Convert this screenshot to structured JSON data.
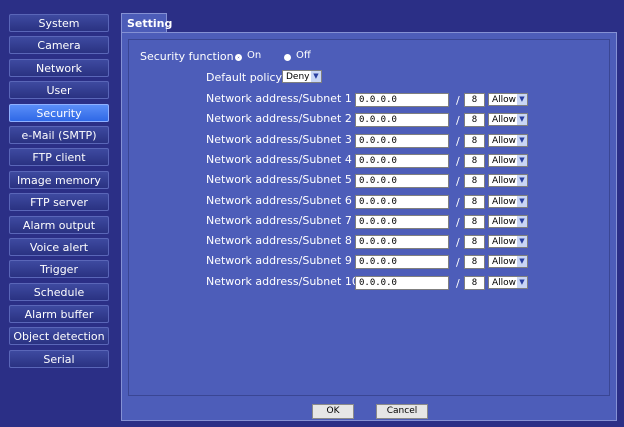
{
  "sidebar": {
    "items": [
      {
        "label": "System"
      },
      {
        "label": "Camera"
      },
      {
        "label": "Network"
      },
      {
        "label": "User"
      },
      {
        "label": "Security"
      },
      {
        "label": "e-Mail (SMTP)"
      },
      {
        "label": "FTP client"
      },
      {
        "label": "Image memory"
      },
      {
        "label": "FTP server"
      },
      {
        "label": "Alarm output"
      },
      {
        "label": "Voice alert"
      },
      {
        "label": "Trigger"
      },
      {
        "label": "Schedule"
      },
      {
        "label": "Alarm buffer"
      },
      {
        "label": "Object detection"
      },
      {
        "label": "Serial"
      }
    ],
    "active_index": 4
  },
  "tab": {
    "label": "Setting"
  },
  "security": {
    "function_label": "Security function",
    "on_label": "On",
    "off_label": "Off",
    "selected": "On",
    "default_policy_label": "Default policy",
    "default_policy_value": "Deny"
  },
  "rows": [
    {
      "label": "Network address/Subnet 1",
      "address": "0.0.0.0",
      "slash": "/",
      "subnet": "8",
      "policy": "Allow"
    },
    {
      "label": "Network address/Subnet 2",
      "address": "0.0.0.0",
      "slash": "/",
      "subnet": "8",
      "policy": "Allow"
    },
    {
      "label": "Network address/Subnet 3",
      "address": "0.0.0.0",
      "slash": "/",
      "subnet": "8",
      "policy": "Allow"
    },
    {
      "label": "Network address/Subnet 4",
      "address": "0.0.0.0",
      "slash": "/",
      "subnet": "8",
      "policy": "Allow"
    },
    {
      "label": "Network address/Subnet 5",
      "address": "0.0.0.0",
      "slash": "/",
      "subnet": "8",
      "policy": "Allow"
    },
    {
      "label": "Network address/Subnet 6",
      "address": "0.0.0.0",
      "slash": "/",
      "subnet": "8",
      "policy": "Allow"
    },
    {
      "label": "Network address/Subnet 7",
      "address": "0.0.0.0",
      "slash": "/",
      "subnet": "8",
      "policy": "Allow"
    },
    {
      "label": "Network address/Subnet 8",
      "address": "0.0.0.0",
      "slash": "/",
      "subnet": "8",
      "policy": "Allow"
    },
    {
      "label": "Network address/Subnet 9",
      "address": "0.0.0.0",
      "slash": "/",
      "subnet": "8",
      "policy": "Allow"
    },
    {
      "label": "Network address/Subnet 10",
      "address": "0.0.0.0",
      "slash": "/",
      "subnet": "8",
      "policy": "Allow"
    }
  ],
  "buttons": {
    "ok": "OK",
    "cancel": "Cancel"
  },
  "icons": {
    "dropdown": "chevron-down-icon"
  },
  "colors": {
    "background": "#2b2f86",
    "panel": "#4d5db9",
    "active_item": "#3b73ea"
  }
}
